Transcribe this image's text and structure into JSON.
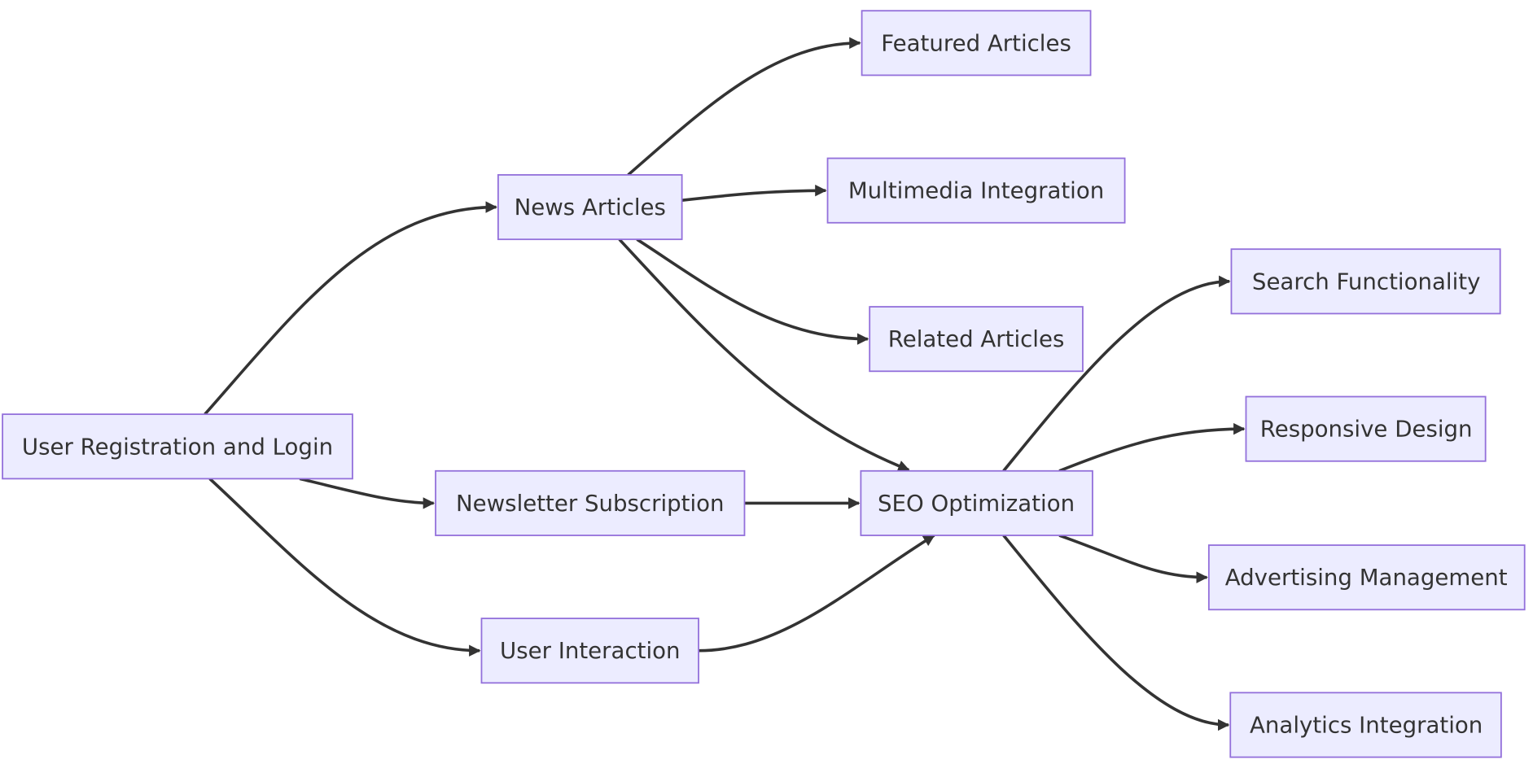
{
  "colors": {
    "node_fill": "#ECECFF",
    "node_stroke": "#9370DB",
    "edge": "#333333"
  },
  "nodes": {
    "user_reg": "User Registration and Login",
    "news": "News Articles",
    "newsletter": "Newsletter Subscription",
    "interaction": "User Interaction",
    "featured": "Featured Articles",
    "multimedia": "Multimedia Integration",
    "related": "Related Articles",
    "seo": "SEO Optimization",
    "search": "Search Functionality",
    "responsive": "Responsive Design",
    "advertising": "Advertising Management",
    "analytics": "Analytics Integration"
  },
  "edges": [
    [
      "user_reg",
      "news"
    ],
    [
      "user_reg",
      "newsletter"
    ],
    [
      "user_reg",
      "interaction"
    ],
    [
      "news",
      "featured"
    ],
    [
      "news",
      "multimedia"
    ],
    [
      "news",
      "related"
    ],
    [
      "news",
      "seo"
    ],
    [
      "newsletter",
      "seo"
    ],
    [
      "interaction",
      "seo"
    ],
    [
      "seo",
      "search"
    ],
    [
      "seo",
      "responsive"
    ],
    [
      "seo",
      "advertising"
    ],
    [
      "seo",
      "analytics"
    ]
  ]
}
